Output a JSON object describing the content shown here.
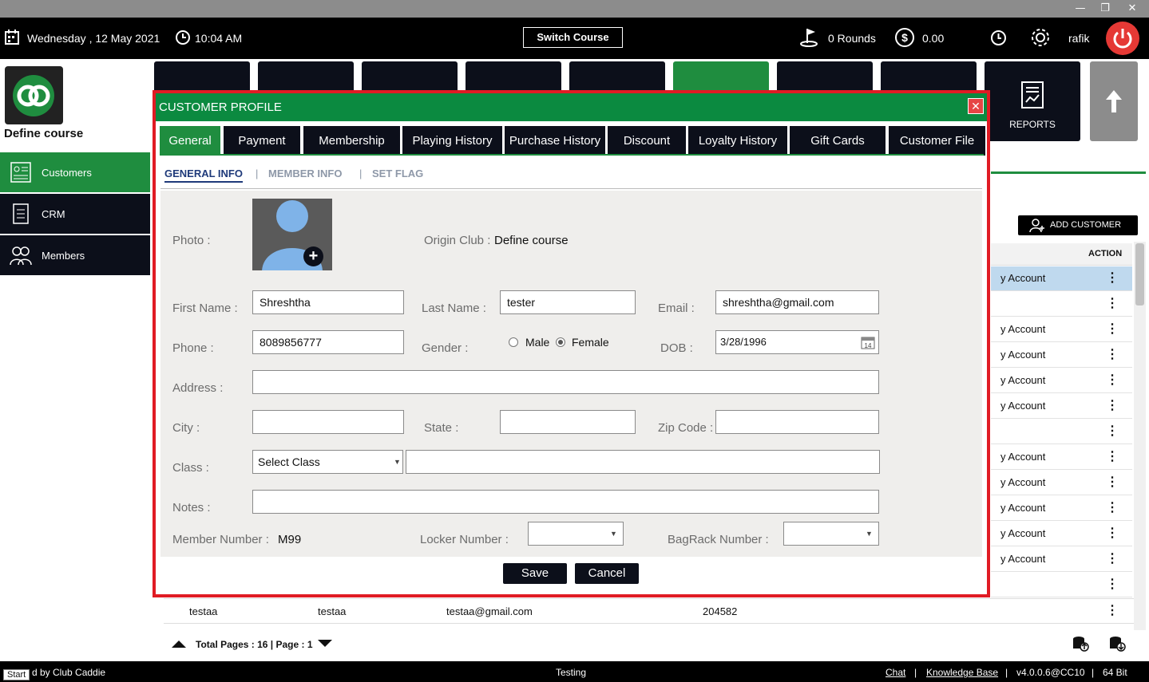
{
  "window": {
    "minimize": "—",
    "restore": "❐",
    "close": "✕"
  },
  "topbar": {
    "date": "Wednesday ,  12 May 2021",
    "time": "10:04 AM",
    "switch_course": "Switch Course",
    "rounds": "0 Rounds",
    "amount": "0.00",
    "user": "rafik"
  },
  "sidebar": {
    "course_name": "Define course",
    "items": [
      {
        "label": "Customers"
      },
      {
        "label": "CRM"
      },
      {
        "label": "Members"
      }
    ]
  },
  "tiles": {
    "reports": "REPORTS"
  },
  "background": {
    "add_customer": "ADD CUSTOMER",
    "action_header": "ACTION",
    "rows": [
      "y Account",
      "",
      "y Account",
      "y Account",
      "y Account",
      "y Account",
      "",
      "y Account",
      "y Account",
      "y Account",
      "y Account",
      "y Account",
      ""
    ],
    "last_row": {
      "first": "testaa",
      "last": "testaa",
      "email": "testaa@gmail.com",
      "number": "204582"
    },
    "pagination": "Total Pages : 16 | Page : 1"
  },
  "modal": {
    "title": "CUSTOMER PROFILE",
    "close": "✕",
    "tabs": [
      {
        "label": "General"
      },
      {
        "label": "Payment"
      },
      {
        "label": "Membership"
      },
      {
        "label": "Playing History"
      },
      {
        "label": "Purchase History"
      },
      {
        "label": "Discount"
      },
      {
        "label": "Loyalty History"
      },
      {
        "label": "Gift Cards"
      },
      {
        "label": "Customer File"
      }
    ],
    "subtabs": {
      "general": "GENERAL INFO",
      "sep": "|",
      "member": "MEMBER INFO",
      "flag": "SET FLAG"
    },
    "form": {
      "photo_label": "Photo :",
      "origin_label": "Origin Club :",
      "origin_value": "Define course",
      "first_name_label": "First Name :",
      "first_name": "Shreshtha",
      "last_name_label": "Last Name :",
      "last_name": "tester",
      "email_label": "Email :",
      "email": "shreshtha@gmail.com",
      "phone_label": "Phone :",
      "phone": "8089856777",
      "gender_label": "Gender :",
      "male": "Male",
      "female": "Female",
      "gender_selected": "Female",
      "dob_label": "DOB :",
      "dob": "3/28/1996",
      "address_label": "Address :",
      "address": "",
      "city_label": "City :",
      "city": "",
      "state_label": "State :",
      "state": "",
      "zip_label": "Zip Code :",
      "zip": "",
      "class_label": "Class :",
      "class_value": "Select Class",
      "notes_label": "Notes :",
      "notes": "",
      "member_number_label": "Member Number :",
      "member_number": "M99",
      "locker_label": "Locker Number :",
      "bagrack_label": "BagRack Number :"
    },
    "save": "Save",
    "cancel": "Cancel"
  },
  "statusbar": {
    "start": "Start",
    "powered": "d by Club Caddie",
    "env": "Testing",
    "chat": "Chat",
    "kb": "Knowledge Base",
    "version": "v4.0.0.6@CC10",
    "bits": "64 Bit",
    "sep": "|"
  },
  "colors": {
    "brand_green": "#1f8d3f",
    "header_green": "#0b8a40",
    "dark": "#0c0f1a",
    "highlight": "#e01b24"
  }
}
